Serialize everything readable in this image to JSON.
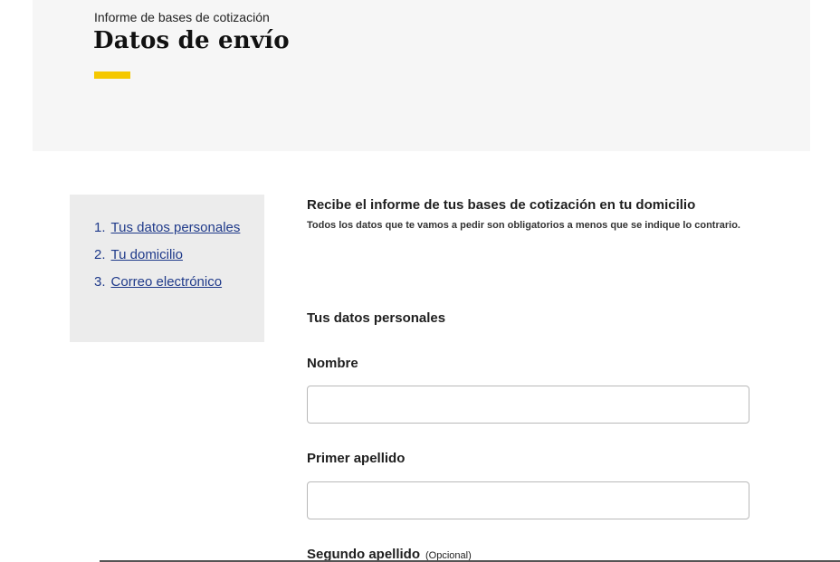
{
  "header": {
    "eyebrow": "Informe de bases de cotización",
    "title": "Datos de envío",
    "accent_color": "#f5c800"
  },
  "steps": [
    {
      "number": "1.",
      "label": "Tus datos personales"
    },
    {
      "number": "2.",
      "label": "Tu domicilio"
    },
    {
      "number": "3.",
      "label": "Correo electrónico"
    }
  ],
  "intro": {
    "title": "Recibe el informe de tus bases de cotización en tu domicilio",
    "note": "Todos los datos que te vamos a pedir son obligatorios a menos que se indique lo contrario."
  },
  "form": {
    "section_title": "Tus datos personales",
    "fields": [
      {
        "label": "Nombre",
        "value": "",
        "optional": ""
      },
      {
        "label": "Primer apellido",
        "value": "",
        "optional": ""
      },
      {
        "label": "Segundo apellido",
        "value": "",
        "optional": "(Opcional)"
      }
    ]
  }
}
